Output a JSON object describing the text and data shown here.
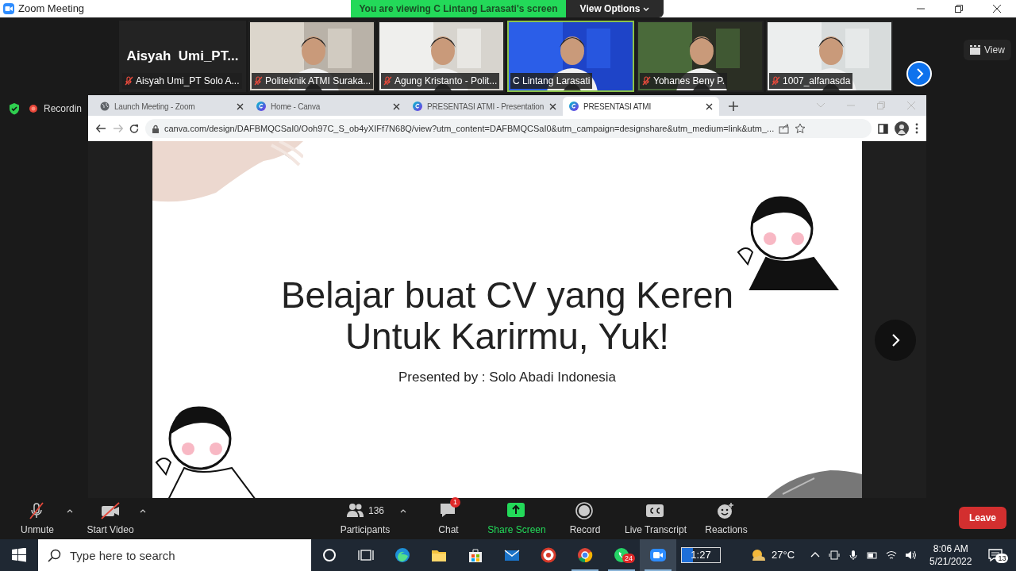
{
  "window": {
    "title": "Zoom Meeting"
  },
  "share_banner": {
    "text": "You are viewing C Lintang Larasati's screen",
    "view_options": "View Options"
  },
  "videos": [
    {
      "kind": "name",
      "display_name": "Aisyah  Umi_PT...",
      "name": "Aisyah Umi_PT Solo A...",
      "muted": true,
      "selected": false
    },
    {
      "kind": "video",
      "name": "Politeknik ATMI Suraka...",
      "muted": true,
      "selected": false
    },
    {
      "kind": "video",
      "name": "Agung Kristanto - Polit...",
      "muted": true,
      "selected": false
    },
    {
      "kind": "video",
      "name": "C Lintang Larasati",
      "muted": false,
      "selected": true
    },
    {
      "kind": "video",
      "name": "Yohanes Beny P.",
      "muted": true,
      "selected": false
    },
    {
      "kind": "video",
      "name": "1007_alfanasda",
      "muted": true,
      "selected": false
    }
  ],
  "view_button": "View",
  "recording": {
    "label": "Recordin"
  },
  "browser": {
    "tabs": [
      {
        "title": "Launch Meeting - Zoom",
        "selected": false
      },
      {
        "title": "Home - Canva",
        "selected": false
      },
      {
        "title": "PRESENTASI ATMI - Presentation",
        "selected": false
      },
      {
        "title": "PRESENTASI ATMI",
        "selected": true
      }
    ],
    "url": "canva.com/design/DAFBMQCSaI0/Ooh97C_S_ob4yXIFf7N68Q/view?utm_content=DAFBMQCSaI0&utm_campaign=designshare&utm_medium=link&utm_..."
  },
  "slide": {
    "title_lines": [
      "Belajar buat CV yang Keren",
      "Untuk Karirmu, Yuk!"
    ],
    "subtitle": "Presented by : Solo Abadi Indonesia"
  },
  "toolbar": {
    "left": [
      {
        "kind": "mic",
        "label": "Unmute"
      },
      {
        "kind": "camera",
        "label": "Start Video"
      }
    ],
    "center": [
      {
        "kind": "participants",
        "label": "Participants",
        "count": "136"
      },
      {
        "kind": "chat",
        "label": "Chat",
        "badge": "1"
      },
      {
        "kind": "share",
        "label": "Share Screen"
      },
      {
        "kind": "record",
        "label": "Record"
      },
      {
        "kind": "cc",
        "label": "Live Transcript"
      },
      {
        "kind": "reactions",
        "label": "Reactions"
      }
    ],
    "leave": "Leave"
  },
  "taskbar": {
    "search_placeholder": "Type here to search",
    "apps": [
      {
        "kind": "cortana",
        "running": false,
        "selected": false
      },
      {
        "kind": "taskview",
        "running": false,
        "selected": false
      },
      {
        "kind": "edge",
        "running": false,
        "selected": false
      },
      {
        "kind": "folder",
        "running": false,
        "selected": false
      },
      {
        "kind": "store",
        "running": false,
        "selected": false
      },
      {
        "kind": "mail",
        "running": false,
        "selected": false
      },
      {
        "kind": "target",
        "running": false,
        "selected": false
      },
      {
        "kind": "chrome",
        "running": true,
        "selected": false
      },
      {
        "kind": "whatsapp",
        "running": true,
        "selected": false,
        "badge": "24"
      },
      {
        "kind": "zoom",
        "running": true,
        "selected": true
      }
    ],
    "battery": "1:27",
    "temperature": "27°C",
    "time": "8:06 AM",
    "date": "5/21/2022",
    "notifications": "13"
  }
}
